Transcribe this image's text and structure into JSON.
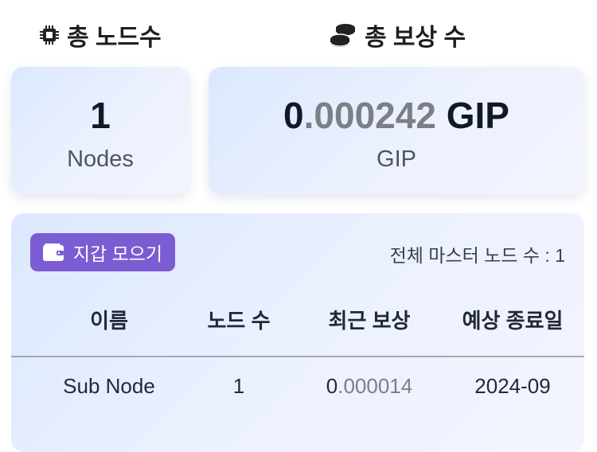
{
  "summary": {
    "nodes_title": "총 노드수",
    "nodes_icon": "chip-icon",
    "rewards_title": "총 보상 수",
    "rewards_icon": "coins-icon",
    "nodes_count": "1",
    "nodes_unit": "Nodes",
    "reward_int": "0",
    "reward_frac": ".000242",
    "reward_suffix": " GIP",
    "reward_unit": "GIP"
  },
  "panel": {
    "wallet_button": "지갑 모으기",
    "wallet_icon": "wallet-icon",
    "total_masters": "전체 마스터 노드 수 : 1"
  },
  "table": {
    "headers": [
      "이름",
      "노드 수",
      "최근 보상",
      "예상 종료일"
    ],
    "rows": [
      {
        "name": "Sub Node",
        "nodes": "1",
        "recent_reward_int": "0",
        "recent_reward_frac": ".000014",
        "end_date": "2024-09"
      }
    ]
  },
  "colors": {
    "accent_button": "#7c5cd3",
    "card_gradient_start": "#dbe8fd",
    "card_gradient_end": "#f3f4fe",
    "muted_digits": "#7b7f86"
  }
}
